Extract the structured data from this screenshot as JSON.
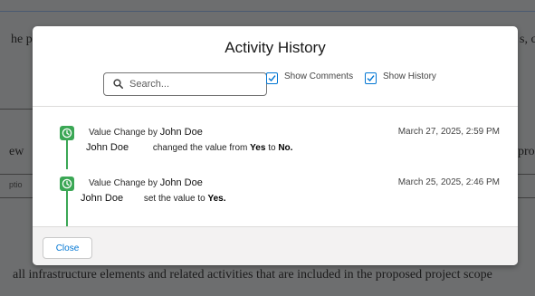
{
  "background": {
    "line1_left": "he p",
    "line1_right": "s, c",
    "line2_left": "ew",
    "line2_right": "pro",
    "small_left": "ptio",
    "bottom_line": "all infrastructure elements and related activities that are included in the proposed project scope"
  },
  "modal": {
    "title": "Activity History",
    "search_placeholder": "Search...",
    "show_comments_label": "Show Comments",
    "show_comments_checked": true,
    "show_history_label": "Show History",
    "show_history_checked": true,
    "items": [
      {
        "action": "Value Change by",
        "author": "John Doe",
        "date": "March 27, 2025, 2:59 PM",
        "who": "John Doe",
        "verb": "changed the value from",
        "from": "Yes",
        "to_word": "to",
        "to": "No."
      },
      {
        "action": "Value Change by",
        "author": "John Doe",
        "date": "March 25, 2025, 2:46 PM",
        "who": "John Doe",
        "verb": "set the value to",
        "to": "Yes."
      }
    ],
    "close_label": "Close"
  },
  "colors": {
    "accent": "#0176d3",
    "timeline_green": "#3ba755"
  }
}
